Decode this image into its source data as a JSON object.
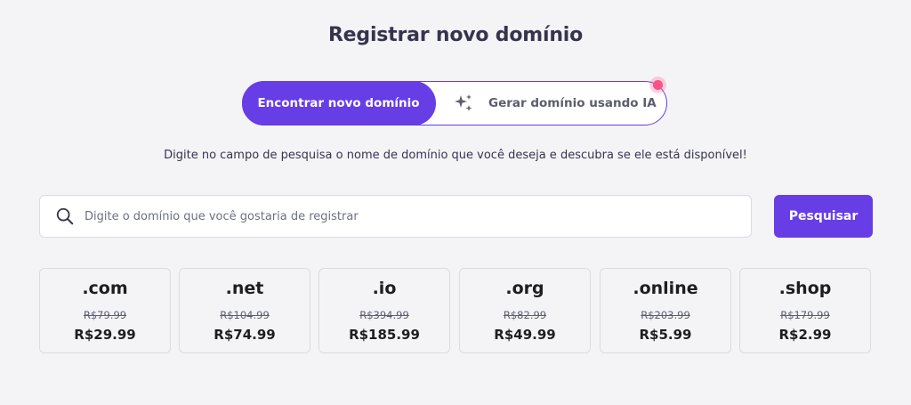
{
  "page": {
    "title": "Registrar novo domínio",
    "subtitle": "Digite no campo de pesquisa o nome de domínio que você deseja e descubra se ele está disponível!"
  },
  "toggle": {
    "active_label": "Encontrar novo domínio",
    "ai_label": "Gerar domínio usando IA",
    "ai_icon": "sparkle-icon",
    "has_notification": true
  },
  "search": {
    "placeholder": "Digite o domínio que você gostaria de registrar",
    "value": "",
    "icon": "search-icon",
    "button_label": "Pesquisar"
  },
  "tlds": [
    {
      "name": ".com",
      "old_price": "R$79.99",
      "price": "R$29.99"
    },
    {
      "name": ".net",
      "old_price": "R$104.99",
      "price": "R$74.99"
    },
    {
      "name": ".io",
      "old_price": "R$394.99",
      "price": "R$185.99"
    },
    {
      "name": ".org",
      "old_price": "R$82.99",
      "price": "R$49.99"
    },
    {
      "name": ".online",
      "old_price": "R$203.99",
      "price": "R$5.99"
    },
    {
      "name": ".shop",
      "old_price": "R$179.99",
      "price": "R$2.99"
    }
  ],
  "colors": {
    "accent": "#673de6",
    "background": "#f4f4f7",
    "notification": "#fc5185"
  }
}
